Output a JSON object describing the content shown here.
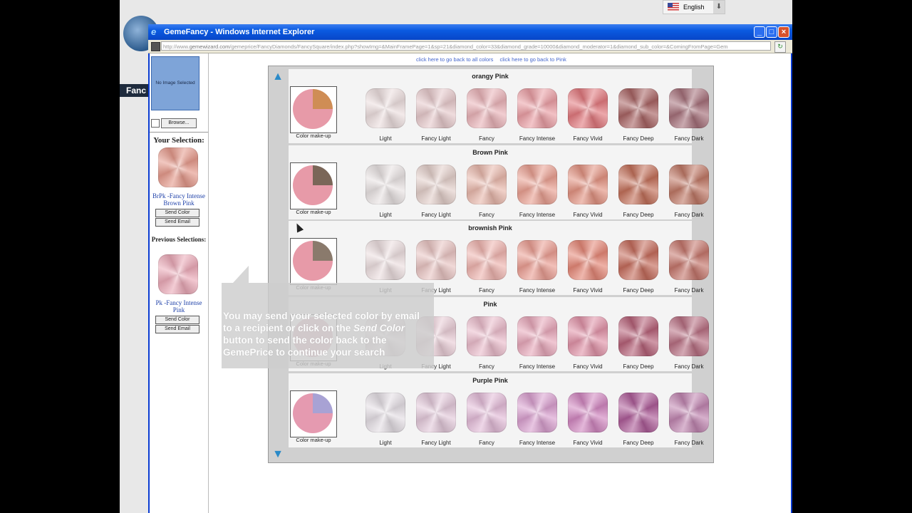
{
  "language": "English",
  "bg_label": "Fanc",
  "window": {
    "title": "GemeFancy - Windows Internet Explorer",
    "url_domain": "gemewizard.com",
    "url_prefix": "http://www.",
    "url_rest": "/gemeprice/FancyDiamonds/FancySquare/index.php?showImg=&MainFramePage=1&sp=21&diamond_color=33&diamond_grade=10000&diamond_moderator=1&diamond_sub_color=&ComingFromPage=Gem"
  },
  "sidebar": {
    "no_image": "No Image Selected",
    "browse": "Browse...",
    "your_selection": "Your Selection:",
    "selected_name": "BrPk -Fancy Intense Brown Pink",
    "previous_selections": "Previous Selections:",
    "previous_name": "Pk -Fancy Intense Pink",
    "send_color": "Send Color",
    "send_email": "Send Email",
    "selected_color": "#e59a8c",
    "previous_color": "#ebaab8"
  },
  "links": {
    "all_colors": "click here to go back to all colors",
    "to_pink": "click here to go back to Pink"
  },
  "grade_labels": [
    "Color make-up",
    "Light",
    "Fancy Light",
    "Fancy",
    "Fancy Intense",
    "Fancy Vivid",
    "Fancy Deep",
    "Fancy Dark"
  ],
  "sections": [
    {
      "title": "orangy Pink",
      "makeup": [
        "#e79aa8",
        "#cf8d55"
      ],
      "colors": [
        "#ecdede",
        "#e6c9cb",
        "#e9b3b8",
        "#ea9fa5",
        "#e1797e",
        "#a86464",
        "#a5707a"
      ]
    },
    {
      "title": "Brown Pink",
      "makeup": [
        "#e79aa8",
        "#7a6658"
      ],
      "colors": [
        "#e8e2e2",
        "#e3cfca",
        "#e8b8ac",
        "#e9a092",
        "#e29382",
        "#c2705a",
        "#bf7866"
      ]
    },
    {
      "title": "brownish Pink",
      "makeup": [
        "#e79aa8",
        "#8a7a6c"
      ],
      "colors": [
        "#ecdedf",
        "#e8c4c2",
        "#eeb4af",
        "#ea9e93",
        "#e48777",
        "#c46c5c",
        "#c4766c"
      ]
    },
    {
      "title": "Pink",
      "makeup": [
        "#e4b6c4",
        "#e4b6c4"
      ],
      "colors": [
        "#ecdfe3",
        "#e9cdd6",
        "#eabccb",
        "#e7a8ba",
        "#e093a8",
        "#b56178",
        "#b76f82"
      ]
    },
    {
      "title": "Purple Pink",
      "makeup": [
        "#e59ab0",
        "#a8a2d4"
      ],
      "colors": [
        "#e4dee4",
        "#e3c9da",
        "#e3bcd8",
        "#d9a0cf",
        "#d187c0",
        "#ad5c98",
        "#c085b0"
      ]
    }
  ],
  "tooltip": {
    "part1": "You may send your selected color by email to a recipient or click on the ",
    "italic": "Send Color",
    "part2": " button to send the color back to the GemePrice to continue your search"
  }
}
